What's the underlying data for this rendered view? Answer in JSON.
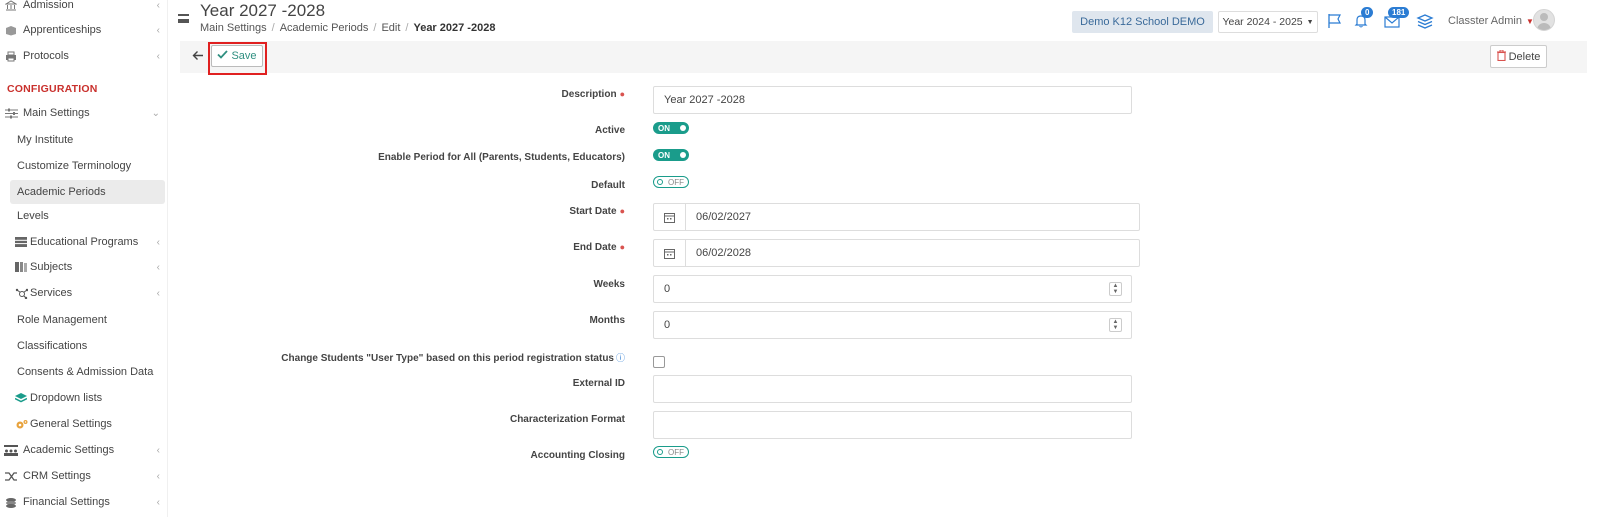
{
  "sidebar": {
    "items_top": [
      {
        "label": "Admission",
        "icon": "bank-icon"
      },
      {
        "label": "Apprenticeships",
        "icon": "box-icon"
      },
      {
        "label": "Protocols",
        "icon": "printer-icon"
      }
    ],
    "config_heading": "CONFIGURATION",
    "main_settings": "Main Settings",
    "sub_items": [
      {
        "label": "My Institute"
      },
      {
        "label": "Customize Terminology"
      },
      {
        "label": "Academic Periods"
      },
      {
        "label": "Levels"
      },
      {
        "label": "Educational Programs"
      },
      {
        "label": "Subjects"
      },
      {
        "label": "Services"
      },
      {
        "label": "Role Management"
      },
      {
        "label": "Classifications"
      },
      {
        "label": "Consents & Admission Data"
      },
      {
        "label": "Dropdown lists"
      },
      {
        "label": "General Settings"
      }
    ],
    "items_bottom": [
      {
        "label": "Academic Settings"
      },
      {
        "label": "CRM Settings"
      },
      {
        "label": "Financial Settings"
      }
    ]
  },
  "header": {
    "title": "Year 2027 -2028",
    "breadcrumb": [
      "Main Settings",
      "Academic Periods",
      "Edit",
      "Year 2027 -2028"
    ],
    "school": "Demo K12 School DEMO",
    "year_select": "Year 2024 - 2025",
    "notifications_count": "0",
    "messages_count": "181",
    "user": "Classter Admin"
  },
  "toolbar": {
    "save_label": "Save",
    "delete_label": "Delete"
  },
  "form": {
    "description_label": "Description",
    "description_value": "Year 2027 -2028",
    "active_label": "Active",
    "active_state": "ON",
    "enable_label": "Enable Period for All (Parents, Students, Educators)",
    "enable_state": "ON",
    "default_label": "Default",
    "default_state": "OFF",
    "start_label": "Start Date",
    "start_value": "06/02/2027",
    "end_label": "End Date",
    "end_value": "06/02/2028",
    "weeks_label": "Weeks",
    "weeks_value": "0",
    "months_label": "Months",
    "months_value": "0",
    "change_label": "Change Students \"User Type\" based on this period registration status",
    "external_label": "External ID",
    "external_value": "",
    "characterization_label": "Characterization Format",
    "characterization_value": "",
    "accounting_label": "Accounting Closing",
    "accounting_state": "OFF"
  },
  "colors": {
    "accent": "#1a9c8b",
    "heading_red": "#c9302c",
    "highlight_red": "#e02020",
    "badge_blue": "#2b7cd3"
  }
}
